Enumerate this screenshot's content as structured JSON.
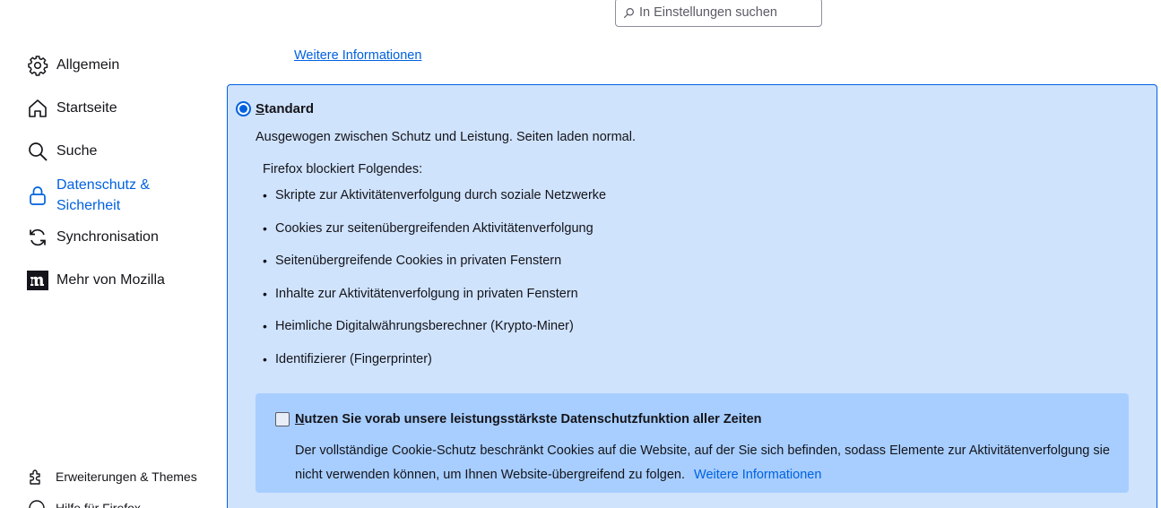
{
  "search": {
    "placeholder": "In Einstellungen suchen"
  },
  "sidebar": {
    "items": [
      {
        "label": "Allgemein",
        "icon": "gear-icon"
      },
      {
        "label": "Startseite",
        "icon": "home-icon"
      },
      {
        "label": "Suche",
        "icon": "search-icon"
      },
      {
        "label": "Datenschutz &",
        "label2": "Sicherheit",
        "icon": "lock-icon",
        "active": true
      },
      {
        "label": "Synchronisation",
        "icon": "sync-icon"
      },
      {
        "label": "Mehr von Mozilla",
        "icon": "mozilla-icon"
      }
    ],
    "footer": [
      {
        "label": "Erweiterungen & Themes",
        "icon": "puzzle-icon"
      },
      {
        "label": "Hilfe für Firefox",
        "icon": "help-icon"
      }
    ]
  },
  "main": {
    "top_link": "Weitere Informationen",
    "standard": {
      "title_access": "S",
      "title_rest": "tandard",
      "selected": true,
      "description": "Ausgewogen zwischen Schutz und Leistung. Seiten laden normal.",
      "blocks_heading": "Firefox blockiert Folgendes:",
      "blocks": [
        "Skripte zur Aktivitätenverfolgung durch soziale Netzwerke",
        "Cookies zur seitenübergreifenden Aktivitätenverfolgung",
        "Seitenübergreifende Cookies in privaten Fenstern",
        "Inhalte zur Aktivitätenverfolgung in privaten Fenstern",
        "Heimliche Digitalwährungsberechner (Krypto-Miner)",
        "Identifizierer (Fingerprinter)"
      ],
      "notice": {
        "checked": false,
        "title_access": "N",
        "title_rest": "utzen Sie vorab unsere leistungsstärkste Datenschutzfunktion aller Zeiten",
        "description": "Der vollständige Cookie-Schutz beschränkt Cookies auf die Website, auf der Sie sich befinden, sodass Elemente zur Aktivitätenverfolgung sie nicht verwenden können, um Ihnen Website-übergreifend zu folgen.",
        "link": "Weitere Informationen"
      }
    }
  },
  "colors": {
    "accent": "#0061e0",
    "panel_bg": "#cfe3fd",
    "notice_bg": "#a7ceff"
  }
}
